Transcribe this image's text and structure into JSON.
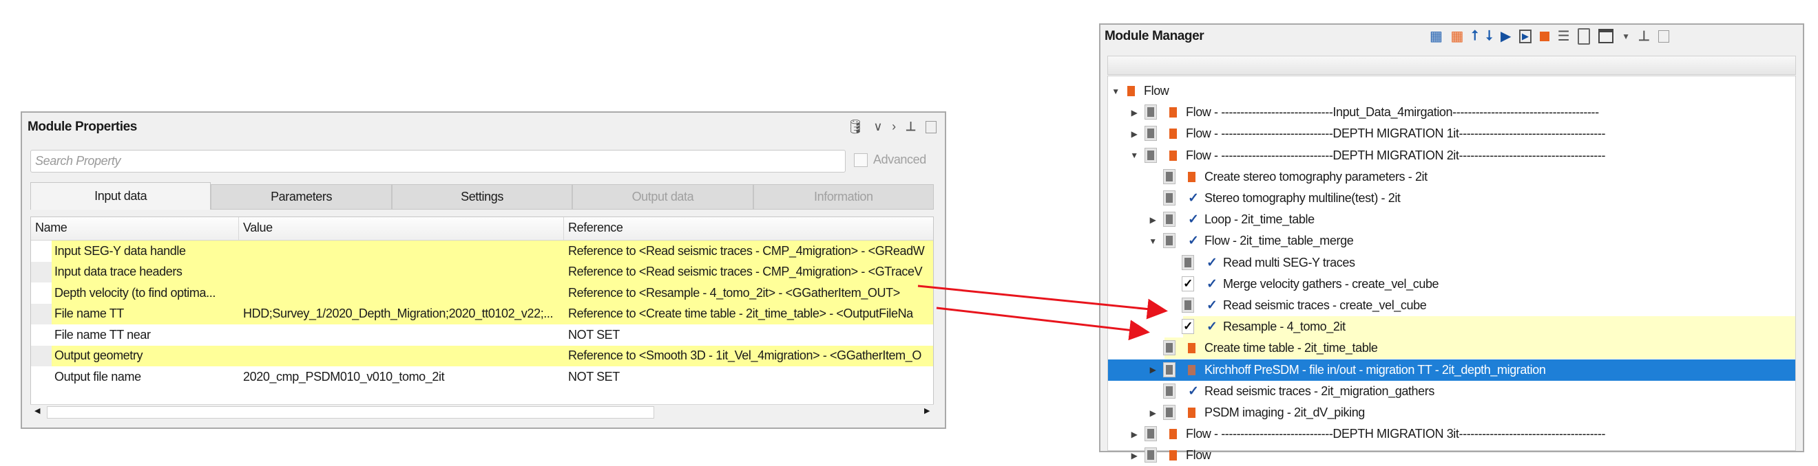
{
  "module_properties": {
    "title": "Module Properties",
    "search_placeholder": "Search Property",
    "advanced_label": "Advanced",
    "tabs": [
      {
        "label": "Input data",
        "state": "active"
      },
      {
        "label": "Parameters",
        "state": "normal"
      },
      {
        "label": "Settings",
        "state": "normal"
      },
      {
        "label": "Output data",
        "state": "disabled"
      },
      {
        "label": "Information",
        "state": "disabled"
      }
    ],
    "columns": [
      "Name",
      "Value",
      "Reference"
    ],
    "rows": [
      {
        "name": "Input SEG-Y data handle",
        "value": "",
        "reference": "Reference to <Read seismic traces - CMP_4migration> - <GReadW",
        "highlight": true
      },
      {
        "name": "Input data trace headers",
        "value": "",
        "reference": "Reference to <Read seismic traces - CMP_4migration> - <GTraceV",
        "highlight": true
      },
      {
        "name": "Depth velocity (to find optima...",
        "value": "",
        "reference": "Reference to <Resample - 4_tomo_2it> - <GGatherItem_OUT>",
        "highlight": true
      },
      {
        "name": "File name TT",
        "value": "HDD;Survey_1/2020_Depth_Migration;2020_tt0102_v22;...",
        "reference": "Reference to <Create time table - 2it_time_table> - <OutputFileNa",
        "highlight": true
      },
      {
        "name": "File name TT near",
        "value": "",
        "reference": "NOT SET",
        "highlight": false
      },
      {
        "name": "Output geometry",
        "value": "",
        "reference": "Reference to <Smooth 3D - 1it_Vel_4migration> - <GGatherItem_O",
        "highlight": true
      },
      {
        "name": "Output file name",
        "value": "2020_cmp_PSDM010_v010_tomo_2it",
        "reference": "NOT SET",
        "highlight": false
      }
    ],
    "header_icons": [
      "database-lock-icon",
      "chevron-down-icon",
      "chevron-right-icon",
      "pin-icon",
      "restore-icon"
    ]
  },
  "module_manager": {
    "title": "Module Manager",
    "toolbar_icons": [
      "add-module-icon",
      "remove-module-icon",
      "move-up-icon",
      "move-down-icon",
      "run-icon",
      "run-step-icon",
      "stop-icon",
      "list-icon",
      "clipboard-icon",
      "window-icon",
      "dropdown-icon",
      "pin-icon",
      "restore-icon"
    ],
    "tree": [
      {
        "label": "Flow",
        "level": 0,
        "expander": "expanded",
        "checkbox": "none",
        "icon": "orange",
        "state": ""
      },
      {
        "label": "Flow - -----------------------------Input_Data_4mirgation--------------------------------------",
        "level": 1,
        "expander": "collapsed",
        "checkbox": "gray",
        "icon": "orange",
        "state": ""
      },
      {
        "label": "Flow - -----------------------------DEPTH MIGRATION 1it--------------------------------------",
        "level": 1,
        "expander": "collapsed",
        "checkbox": "gray",
        "icon": "orange",
        "state": ""
      },
      {
        "label": "Flow - -----------------------------DEPTH MIGRATION 2it--------------------------------------",
        "level": 1,
        "expander": "expanded",
        "checkbox": "gray",
        "icon": "orange",
        "state": ""
      },
      {
        "label": "Create stereo tomography parameters - 2it",
        "level": 2,
        "expander": "none",
        "checkbox": "gray",
        "icon": "orange",
        "state": ""
      },
      {
        "label": "Stereo tomography multiline(test) - 2it",
        "level": 2,
        "expander": "none",
        "checkbox": "gray",
        "icon": "check",
        "state": ""
      },
      {
        "label": "Loop - 2it_time_table",
        "level": 2,
        "expander": "collapsed",
        "checkbox": "gray",
        "icon": "check",
        "state": ""
      },
      {
        "label": "Flow - 2it_time_table_merge",
        "level": 2,
        "expander": "expanded",
        "checkbox": "gray",
        "icon": "check",
        "state": ""
      },
      {
        "label": "Read multi SEG-Y traces",
        "level": 3,
        "expander": "none",
        "checkbox": "gray",
        "icon": "check",
        "state": ""
      },
      {
        "label": "Merge velocity gathers - create_vel_cube",
        "level": 3,
        "expander": "none",
        "checkbox": "checked",
        "icon": "check",
        "state": ""
      },
      {
        "label": "Read seismic traces - create_vel_cube",
        "level": 3,
        "expander": "none",
        "checkbox": "gray",
        "icon": "check",
        "state": ""
      },
      {
        "label": "Resample - 4_tomo_2it",
        "level": 3,
        "expander": "none",
        "checkbox": "checked",
        "icon": "check",
        "state": "highlight"
      },
      {
        "label": "Create time table - 2it_time_table",
        "level": 2,
        "expander": "none",
        "checkbox": "gray",
        "icon": "orange",
        "state": "highlight"
      },
      {
        "label": "Kirchhoff PreSDM - file in/out - migration TT - 2it_depth_migration",
        "level": 2,
        "expander": "collapsed",
        "checkbox": "gray",
        "icon": "brown",
        "state": "selected"
      },
      {
        "label": "Read seismic traces - 2it_migration_gathers",
        "level": 2,
        "expander": "none",
        "checkbox": "gray",
        "icon": "check",
        "state": ""
      },
      {
        "label": "PSDM imaging - 2it_dV_piking",
        "level": 2,
        "expander": "collapsed",
        "checkbox": "gray",
        "icon": "orange",
        "state": ""
      },
      {
        "label": "Flow - -----------------------------DEPTH MIGRATION 3it--------------------------------------",
        "level": 1,
        "expander": "collapsed",
        "checkbox": "gray",
        "icon": "orange",
        "state": ""
      },
      {
        "label": "Flow",
        "level": 1,
        "expander": "collapsed",
        "checkbox": "gray",
        "icon": "orange",
        "state": ""
      }
    ]
  },
  "colors": {
    "highlight": "#ffff99",
    "selected": "#1e7fd7",
    "orange": "#e8601c",
    "arrow": "#e8141c",
    "check": "#1f4fa0"
  }
}
